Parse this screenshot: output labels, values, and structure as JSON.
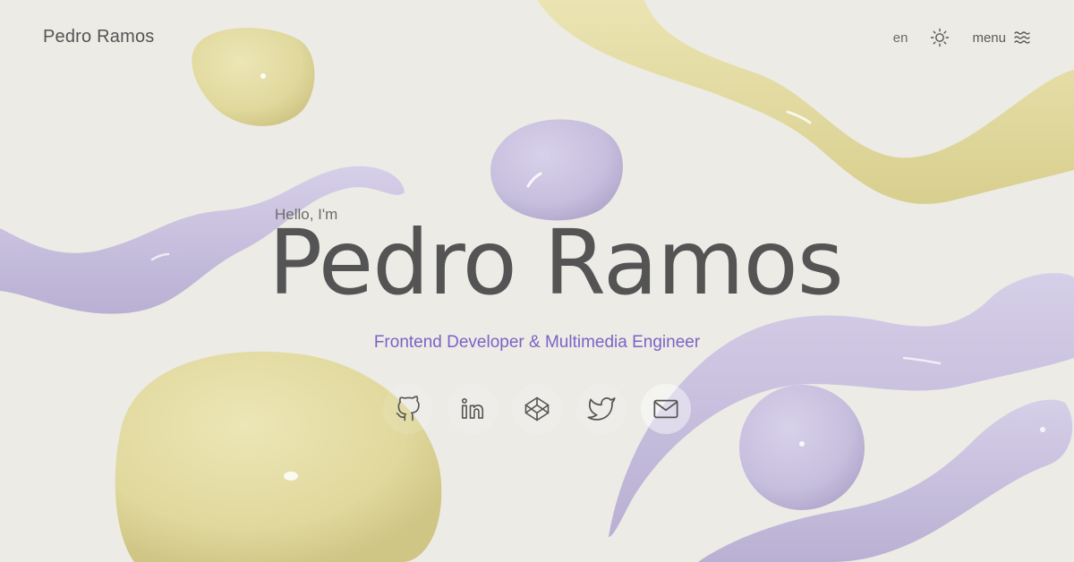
{
  "header": {
    "brand": "Pedro Ramos",
    "lang": "en",
    "theme_icon": "sun-icon",
    "menu_label": "menu",
    "menu_icon": "waves-menu-icon"
  },
  "hero": {
    "greeting": "Hello, I'm",
    "name": "Pedro Ramos",
    "subtitle": "Frontend Developer & Multimedia Engineer"
  },
  "socials": [
    {
      "name": "GitHub",
      "icon": "github-icon"
    },
    {
      "name": "LinkedIn",
      "icon": "linkedin-icon"
    },
    {
      "name": "CodePen",
      "icon": "codepen-icon"
    },
    {
      "name": "Twitter",
      "icon": "twitter-icon"
    },
    {
      "name": "Email",
      "icon": "mail-icon"
    }
  ],
  "colors": {
    "background": "#ecebe6",
    "text": "#545454",
    "accent": "#7c63c6",
    "blob_yellow": "#e3dba0",
    "blob_purple": "#c9c1de"
  }
}
